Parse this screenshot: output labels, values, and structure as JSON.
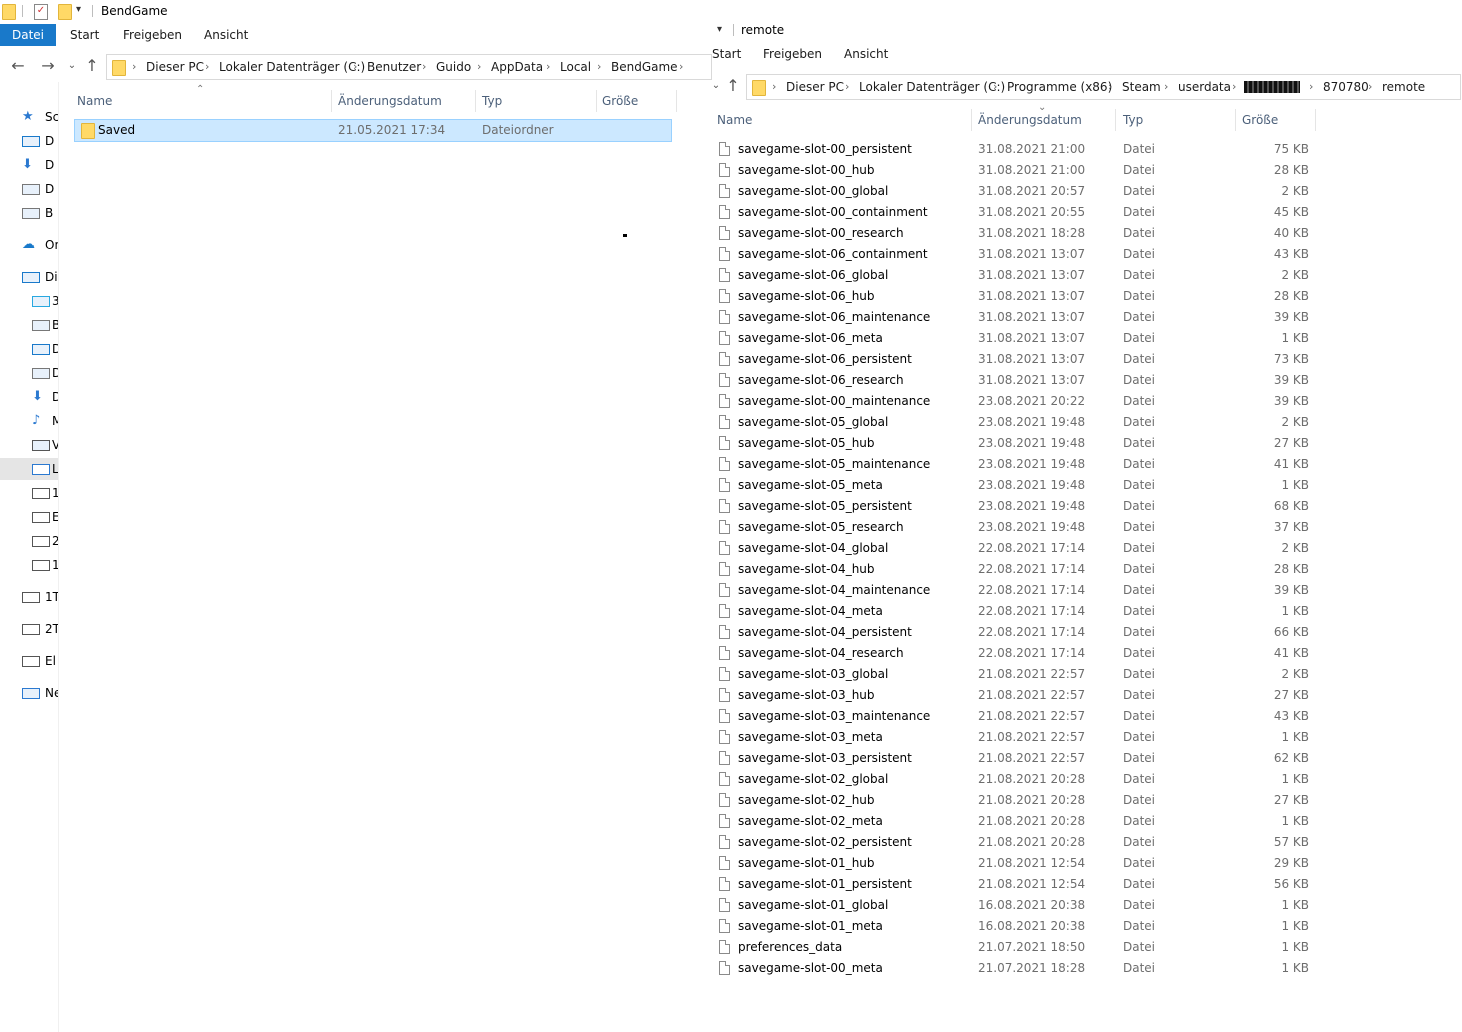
{
  "left": {
    "title": "BendGame",
    "ribbon": {
      "file": "Datei",
      "tabs": [
        "Start",
        "Freigeben",
        "Ansicht"
      ]
    },
    "breadcrumb": [
      "Dieser PC",
      "Lokaler Datenträger (C:)",
      "Benutzer",
      "Guido",
      "AppData",
      "Local",
      "BendGame"
    ],
    "columns": {
      "name": "Name",
      "date": "Änderungsdatum",
      "type": "Typ",
      "size": "Größe"
    },
    "rows": [
      {
        "name": "Saved",
        "date": "21.05.2021 17:34",
        "type": "Dateiordner",
        "size": ""
      }
    ],
    "nav": [
      "Sc",
      "D",
      "D",
      "D",
      "B",
      "On",
      "Di",
      "3",
      "B",
      "D",
      "D",
      "D",
      "M",
      "V",
      "L",
      "1",
      "E",
      "2",
      "1",
      "1T",
      "2T",
      "El",
      "Ne"
    ]
  },
  "right": {
    "title": "remote",
    "ribbon": {
      "tabs": [
        "Start",
        "Freigeben",
        "Ansicht"
      ]
    },
    "breadcrumb": [
      "Dieser PC",
      "Lokaler Datenträger (C:)",
      "Programme (x86)",
      "Steam",
      "userdata",
      "",
      "870780",
      "remote"
    ],
    "columns": {
      "name": "Name",
      "date": "Änderungsdatum",
      "type": "Typ",
      "size": "Größe"
    },
    "rows": [
      {
        "name": "savegame-slot-00_persistent",
        "date": "31.08.2021 21:00",
        "type": "Datei",
        "size": "75 KB"
      },
      {
        "name": "savegame-slot-00_hub",
        "date": "31.08.2021 21:00",
        "type": "Datei",
        "size": "28 KB"
      },
      {
        "name": "savegame-slot-00_global",
        "date": "31.08.2021 20:57",
        "type": "Datei",
        "size": "2 KB"
      },
      {
        "name": "savegame-slot-00_containment",
        "date": "31.08.2021 20:55",
        "type": "Datei",
        "size": "45 KB"
      },
      {
        "name": "savegame-slot-00_research",
        "date": "31.08.2021 18:28",
        "type": "Datei",
        "size": "40 KB"
      },
      {
        "name": "savegame-slot-06_containment",
        "date": "31.08.2021 13:07",
        "type": "Datei",
        "size": "43 KB"
      },
      {
        "name": "savegame-slot-06_global",
        "date": "31.08.2021 13:07",
        "type": "Datei",
        "size": "2 KB"
      },
      {
        "name": "savegame-slot-06_hub",
        "date": "31.08.2021 13:07",
        "type": "Datei",
        "size": "28 KB"
      },
      {
        "name": "savegame-slot-06_maintenance",
        "date": "31.08.2021 13:07",
        "type": "Datei",
        "size": "39 KB"
      },
      {
        "name": "savegame-slot-06_meta",
        "date": "31.08.2021 13:07",
        "type": "Datei",
        "size": "1 KB"
      },
      {
        "name": "savegame-slot-06_persistent",
        "date": "31.08.2021 13:07",
        "type": "Datei",
        "size": "73 KB"
      },
      {
        "name": "savegame-slot-06_research",
        "date": "31.08.2021 13:07",
        "type": "Datei",
        "size": "39 KB"
      },
      {
        "name": "savegame-slot-00_maintenance",
        "date": "23.08.2021 20:22",
        "type": "Datei",
        "size": "39 KB"
      },
      {
        "name": "savegame-slot-05_global",
        "date": "23.08.2021 19:48",
        "type": "Datei",
        "size": "2 KB"
      },
      {
        "name": "savegame-slot-05_hub",
        "date": "23.08.2021 19:48",
        "type": "Datei",
        "size": "27 KB"
      },
      {
        "name": "savegame-slot-05_maintenance",
        "date": "23.08.2021 19:48",
        "type": "Datei",
        "size": "41 KB"
      },
      {
        "name": "savegame-slot-05_meta",
        "date": "23.08.2021 19:48",
        "type": "Datei",
        "size": "1 KB"
      },
      {
        "name": "savegame-slot-05_persistent",
        "date": "23.08.2021 19:48",
        "type": "Datei",
        "size": "68 KB"
      },
      {
        "name": "savegame-slot-05_research",
        "date": "23.08.2021 19:48",
        "type": "Datei",
        "size": "37 KB"
      },
      {
        "name": "savegame-slot-04_global",
        "date": "22.08.2021 17:14",
        "type": "Datei",
        "size": "2 KB"
      },
      {
        "name": "savegame-slot-04_hub",
        "date": "22.08.2021 17:14",
        "type": "Datei",
        "size": "28 KB"
      },
      {
        "name": "savegame-slot-04_maintenance",
        "date": "22.08.2021 17:14",
        "type": "Datei",
        "size": "39 KB"
      },
      {
        "name": "savegame-slot-04_meta",
        "date": "22.08.2021 17:14",
        "type": "Datei",
        "size": "1 KB"
      },
      {
        "name": "savegame-slot-04_persistent",
        "date": "22.08.2021 17:14",
        "type": "Datei",
        "size": "66 KB"
      },
      {
        "name": "savegame-slot-04_research",
        "date": "22.08.2021 17:14",
        "type": "Datei",
        "size": "41 KB"
      },
      {
        "name": "savegame-slot-03_global",
        "date": "21.08.2021 22:57",
        "type": "Datei",
        "size": "2 KB"
      },
      {
        "name": "savegame-slot-03_hub",
        "date": "21.08.2021 22:57",
        "type": "Datei",
        "size": "27 KB"
      },
      {
        "name": "savegame-slot-03_maintenance",
        "date": "21.08.2021 22:57",
        "type": "Datei",
        "size": "43 KB"
      },
      {
        "name": "savegame-slot-03_meta",
        "date": "21.08.2021 22:57",
        "type": "Datei",
        "size": "1 KB"
      },
      {
        "name": "savegame-slot-03_persistent",
        "date": "21.08.2021 22:57",
        "type": "Datei",
        "size": "62 KB"
      },
      {
        "name": "savegame-slot-02_global",
        "date": "21.08.2021 20:28",
        "type": "Datei",
        "size": "1 KB"
      },
      {
        "name": "savegame-slot-02_hub",
        "date": "21.08.2021 20:28",
        "type": "Datei",
        "size": "27 KB"
      },
      {
        "name": "savegame-slot-02_meta",
        "date": "21.08.2021 20:28",
        "type": "Datei",
        "size": "1 KB"
      },
      {
        "name": "savegame-slot-02_persistent",
        "date": "21.08.2021 20:28",
        "type": "Datei",
        "size": "57 KB"
      },
      {
        "name": "savegame-slot-01_hub",
        "date": "21.08.2021 12:54",
        "type": "Datei",
        "size": "29 KB"
      },
      {
        "name": "savegame-slot-01_persistent",
        "date": "21.08.2021 12:54",
        "type": "Datei",
        "size": "56 KB"
      },
      {
        "name": "savegame-slot-01_global",
        "date": "16.08.2021 20:38",
        "type": "Datei",
        "size": "1 KB"
      },
      {
        "name": "savegame-slot-01_meta",
        "date": "16.08.2021 20:38",
        "type": "Datei",
        "size": "1 KB"
      },
      {
        "name": "preferences_data",
        "date": "21.07.2021 18:50",
        "type": "Datei",
        "size": "1 KB"
      },
      {
        "name": "savegame-slot-00_meta",
        "date": "21.07.2021 18:28",
        "type": "Datei",
        "size": "1 KB"
      }
    ]
  },
  "colors": {
    "accent": "#1979ca",
    "selection": "#cce8ff",
    "selection_border": "#99d1ff",
    "folder": "#ffd966",
    "header_text": "#4c607a"
  }
}
